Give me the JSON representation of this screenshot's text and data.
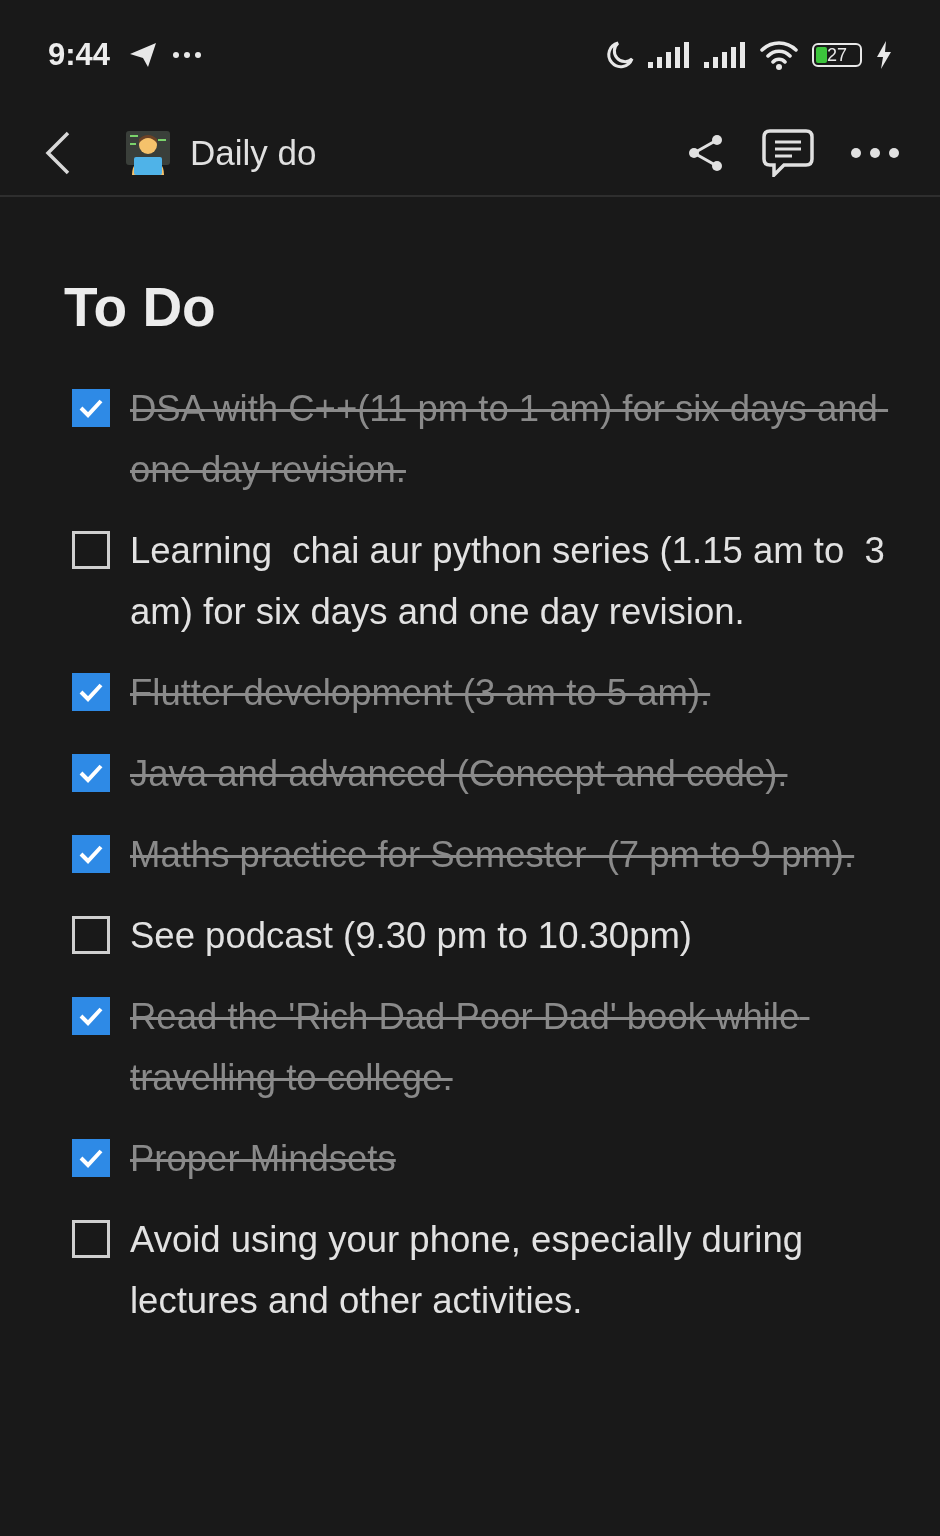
{
  "status_bar": {
    "time": "9:44",
    "battery": "27"
  },
  "header": {
    "title": "Daily do"
  },
  "heading": "To Do",
  "todos": [
    {
      "text": "DSA with C++(11 pm to 1 am) for six days and one day revision.",
      "checked": true
    },
    {
      "text": "Learning  chai aur python series (1.15 am to  3 am) for six days and one day revision.",
      "checked": false
    },
    {
      "text": "Flutter development (3 am to 5 am).",
      "checked": true
    },
    {
      "text": "Java and advanced (Concept and code).",
      "checked": true
    },
    {
      "text": "Maths practice for Semester  (7 pm to 9 pm).",
      "checked": true
    },
    {
      "text": "See podcast (9.30 pm to 10.30pm)",
      "checked": false
    },
    {
      "text": "Read the 'Rich Dad Poor Dad' book while travelling to college.",
      "checked": true
    },
    {
      "text": "Proper Mindsets",
      "checked": true
    },
    {
      "text": "Avoid using your phone, especially during lectures and other activities.",
      "checked": false
    }
  ]
}
